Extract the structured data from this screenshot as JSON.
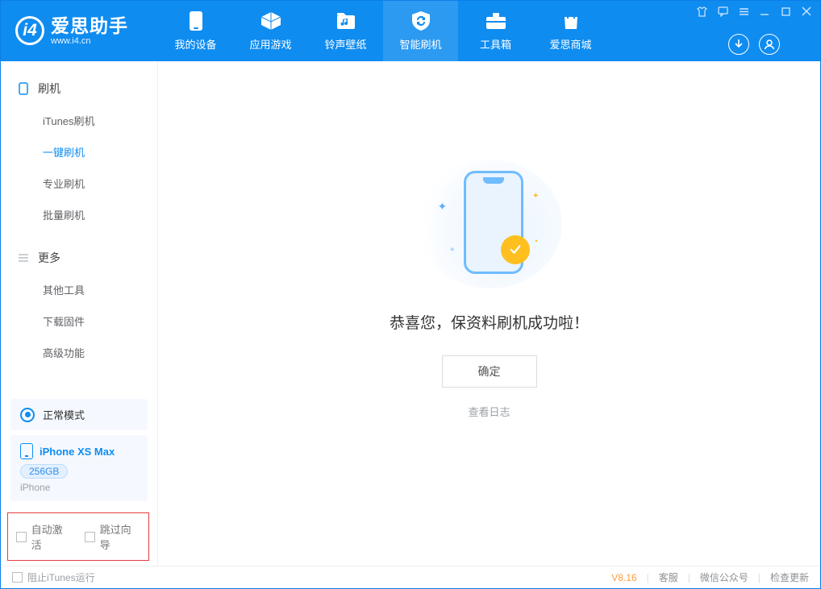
{
  "app": {
    "name_cn": "爱思助手",
    "name_en": "www.i4.cn"
  },
  "tabs": [
    {
      "label": "我的设备"
    },
    {
      "label": "应用游戏"
    },
    {
      "label": "铃声壁纸"
    },
    {
      "label": "智能刷机"
    },
    {
      "label": "工具箱"
    },
    {
      "label": "爱思商城"
    }
  ],
  "sidebar": {
    "section_flash": "刷机",
    "items_flash": [
      {
        "label": "iTunes刷机"
      },
      {
        "label": "一键刷机"
      },
      {
        "label": "专业刷机"
      },
      {
        "label": "批量刷机"
      }
    ],
    "section_more": "更多",
    "items_more": [
      {
        "label": "其他工具"
      },
      {
        "label": "下载固件"
      },
      {
        "label": "高级功能"
      }
    ]
  },
  "mode": {
    "label": "正常模式"
  },
  "device": {
    "name": "iPhone XS Max",
    "capacity": "256GB",
    "type": "iPhone"
  },
  "checks": {
    "auto_activate": "自动激活",
    "skip_guide": "跳过向导"
  },
  "main": {
    "success_msg": "恭喜您，保资料刷机成功啦！",
    "ok": "确定",
    "view_log": "查看日志"
  },
  "footer": {
    "block_itunes": "阻止iTunes运行",
    "version": "V8.16",
    "support": "客服",
    "wechat": "微信公众号",
    "update": "检查更新"
  }
}
